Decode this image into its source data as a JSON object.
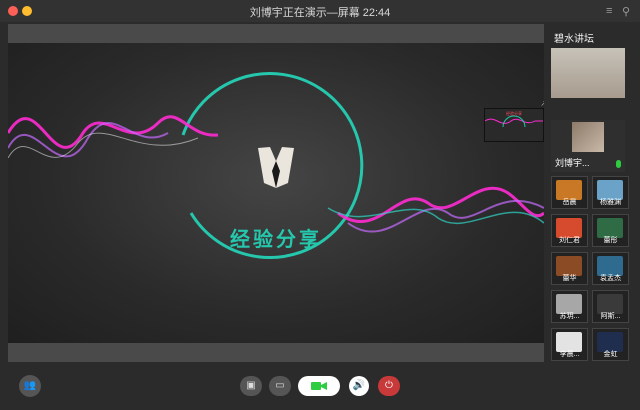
{
  "window": {
    "title": "刘博宇正在演示—屏幕 22:44"
  },
  "slide": {
    "title": "经验分享",
    "thumbnail_label": "经验分享"
  },
  "sidebar": {
    "room_name": "碧水讲坛",
    "main_video_name": "",
    "presenter_name": "刘博宇...",
    "grid": [
      {
        "name": "岳晨"
      },
      {
        "name": "杨雅渊"
      },
      {
        "name": "刘仁君"
      },
      {
        "name": "蕾彤"
      },
      {
        "name": "蕾华"
      },
      {
        "name": "袁孟杰"
      },
      {
        "name": "苏玥..."
      },
      {
        "name": "阿斯..."
      },
      {
        "name": "李晨..."
      },
      {
        "name": "金虹"
      }
    ]
  },
  "colors": {
    "accent": "#25c7ad",
    "wave_magenta": "#ff2bd3",
    "leave": "#c83a3a"
  }
}
